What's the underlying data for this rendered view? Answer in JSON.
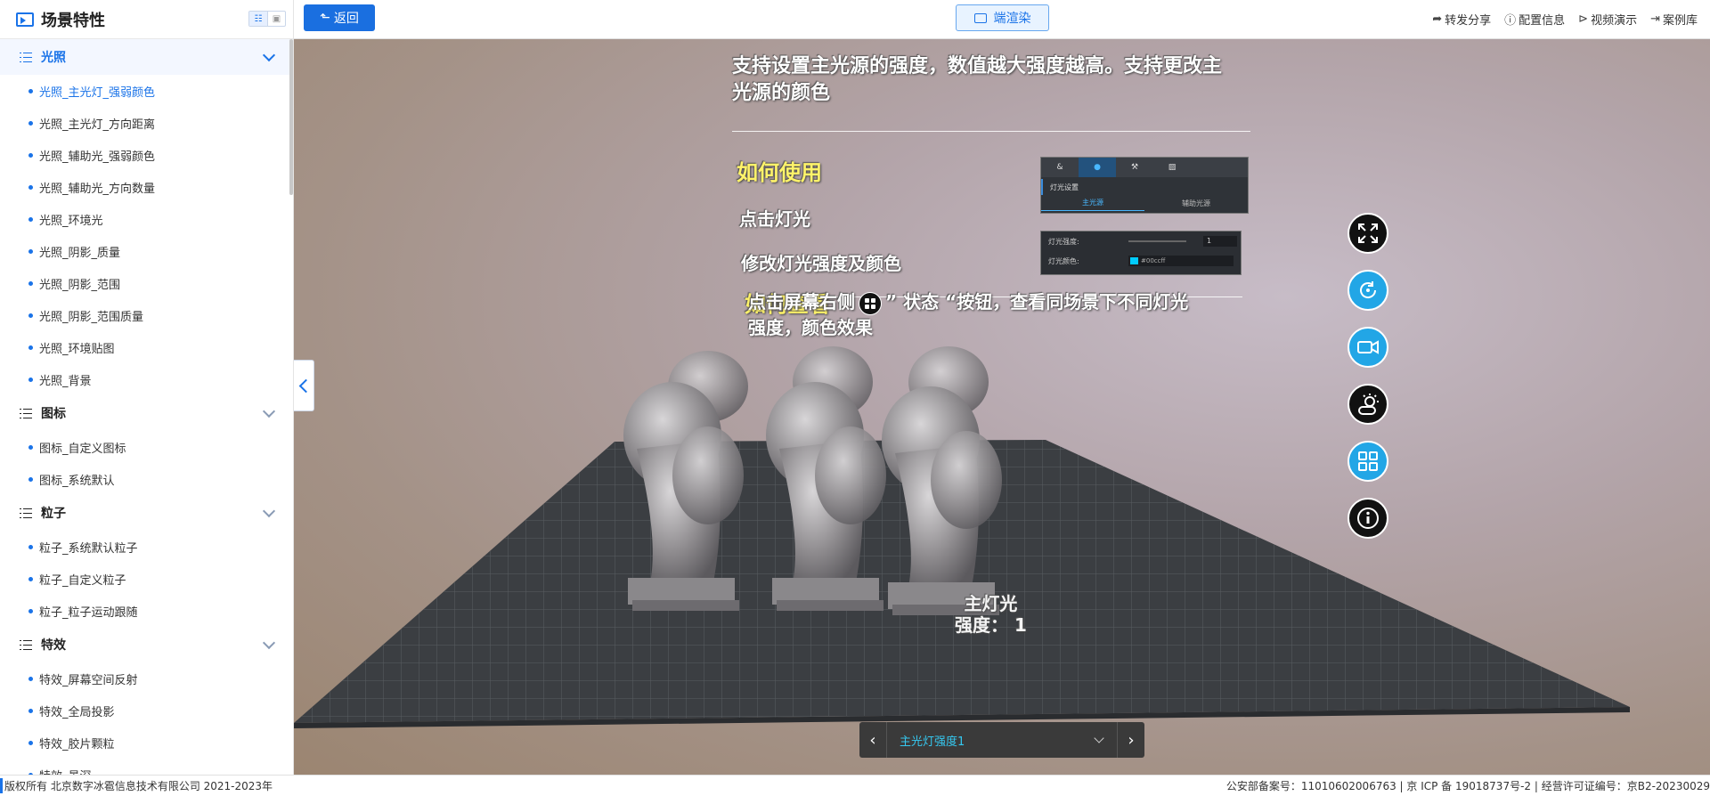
{
  "sidebar": {
    "title": "场景特性",
    "groups": [
      {
        "label": "光照",
        "items": [
          "光照_主光灯_强弱颜色",
          "光照_主光灯_方向距离",
          "光照_辅助光_强弱颜色",
          "光照_辅助光_方向数量",
          "光照_环境光",
          "光照_阴影_质量",
          "光照_阴影_范围",
          "光照_阴影_范围质量",
          "光照_环境贴图",
          "光照_背景"
        ]
      },
      {
        "label": "图标",
        "items": [
          "图标_自定义图标",
          "图标_系统默认"
        ]
      },
      {
        "label": "粒子",
        "items": [
          "粒子_系统默认粒子",
          "粒子_自定义粒子",
          "粒子_粒子运动跟随"
        ]
      },
      {
        "label": "特效",
        "items": [
          "特效_屏幕空间反射",
          "特效_全局投影",
          "特效_胶片颗粒",
          "特效_景深"
        ]
      }
    ]
  },
  "topbar": {
    "back_label": "返回",
    "render_label": "端渲染",
    "links": {
      "share": "转发分享",
      "config": "配置信息",
      "video": "视频演示",
      "cases": "案例库"
    }
  },
  "viewport": {
    "intro": [
      "支持设置主光源的强度，数值越大强度越高。支持更改主",
      "光源的颜色"
    ],
    "how_to_use_title": "如何使用",
    "step1": "点击灯光",
    "step2": "修改灯光强度及颜色",
    "how_to_view_title": "如何查看",
    "view_line1_a": "点击屏幕右侧",
    "view_line1_b": "” 状态 “按钮，查看同场景下不同灯光",
    "view_line2": "强度，颜色效果",
    "scene_label_1": "主灯光",
    "scene_label_2": "强度： 1",
    "thumb": {
      "section": "灯光设置",
      "tab_main": "主光源",
      "tab_aux": "辅助光源",
      "intensity_label": "灯光强度:",
      "intensity_value": "1",
      "color_label": "灯光颜色:",
      "color_value": "#00ccff"
    },
    "scene_select": {
      "value": "主光灯强度1"
    }
  },
  "footer": {
    "left": "版权所有 北京数字冰雹信息技术有限公司 2021-2023年",
    "right": "公安部备案号：11010602006763 | 京 ICP 备 19018737号-2 | 经营许可证编号：京B2-20230029"
  },
  "colors": {
    "accent": "#1a73e8",
    "fab_blue": "#22a6e6",
    "highlight_yellow": "#fff36a",
    "scene_select_text": "#35c8f0"
  }
}
